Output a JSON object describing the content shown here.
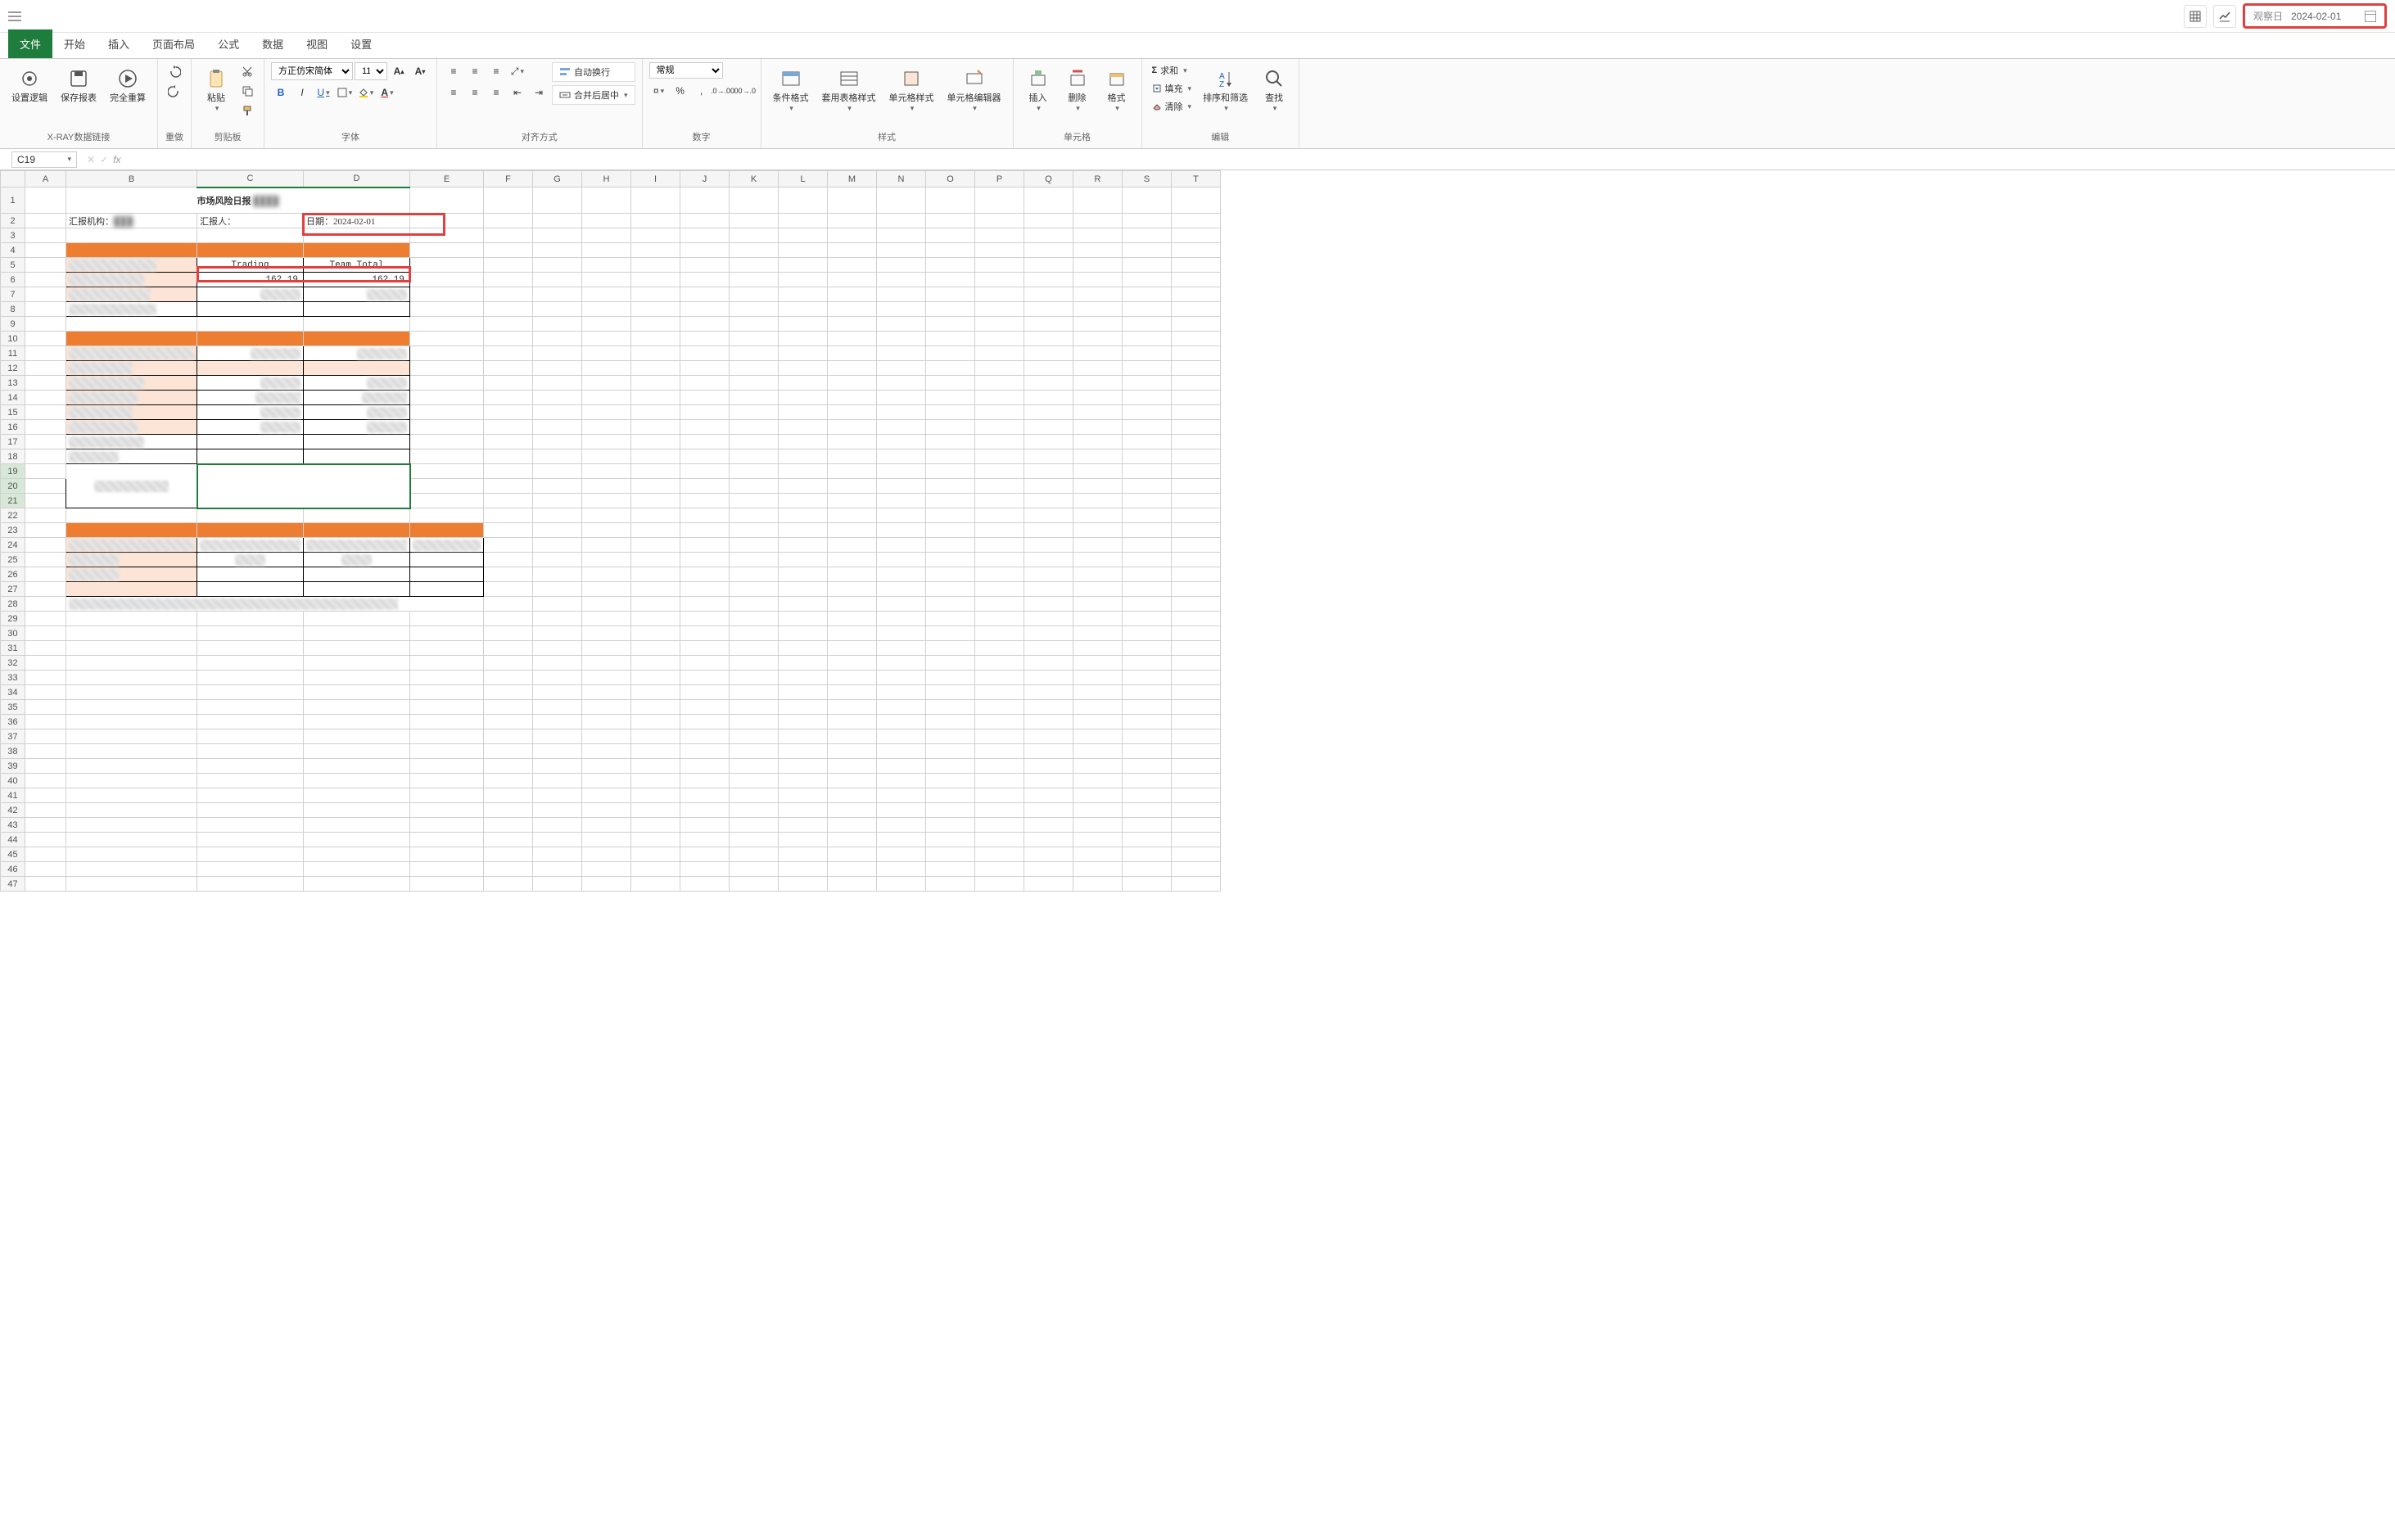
{
  "topbar": {
    "observe_label": "观察日",
    "date_value": "2024-02-01"
  },
  "menu": {
    "tabs": [
      "文件",
      "开始",
      "插入",
      "页面布局",
      "公式",
      "数据",
      "视图",
      "设置"
    ],
    "active_index": 0
  },
  "ribbon": {
    "xray": {
      "set_logic": "设置逻辑",
      "save_report": "保存报表",
      "full_recalc": "完全重算",
      "group": "X-RAY数据链接"
    },
    "undo": {
      "group": "重做"
    },
    "clipboard": {
      "paste": "粘贴",
      "group": "剪贴板"
    },
    "font": {
      "name": "方正仿宋简体",
      "size": "11",
      "group": "字体"
    },
    "align": {
      "wrap": "自动换行",
      "merge": "合并后居中",
      "group": "对齐方式"
    },
    "number": {
      "format": "常规",
      "group": "数字"
    },
    "styles": {
      "cond": "条件格式",
      "table": "套用表格样式",
      "cell": "单元格样式",
      "group": "样式"
    },
    "cells": {
      "insert": "插入",
      "delete": "删除",
      "format": "格式",
      "editor": "单元格编辑器",
      "group": "单元格"
    },
    "editing": {
      "sum": "求和",
      "fill": "填充",
      "clear": "清除",
      "sort": "排序和筛选",
      "find": "查找",
      "group": "编辑"
    }
  },
  "formula_bar": {
    "name_box": "C19"
  },
  "columns": [
    "A",
    "B",
    "C",
    "D",
    "E",
    "F",
    "G",
    "H",
    "I",
    "J",
    "K",
    "L",
    "M",
    "N",
    "O",
    "P",
    "Q",
    "R",
    "S",
    "T"
  ],
  "report": {
    "title": "市场风险日报",
    "org_label": "汇报机构：",
    "reporter_label": "汇报人：",
    "date_label": "日期：",
    "date_value": "2024-02-01",
    "col_trading": "Trading",
    "col_team_total": "Team Total",
    "val_trading": "162.19",
    "val_team_total": "162.19"
  }
}
